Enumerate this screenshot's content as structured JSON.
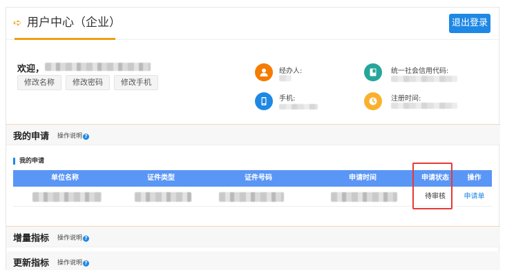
{
  "header": {
    "title": "用户中心（企业）",
    "logout_label": "退出登录",
    "accent_color": "#f39c12",
    "arrow_icon": "arrow-right-icon"
  },
  "profile": {
    "welcome_label": "欢迎，",
    "buttons": [
      "修改名称",
      "修改密码",
      "修改手机"
    ],
    "fields": [
      {
        "label": "经办人:",
        "icon": "person-icon",
        "color": "#f57c00"
      },
      {
        "label": "手机:",
        "icon": "phone-icon",
        "color": "#1e88e5"
      },
      {
        "label": "统一社会信用代码:",
        "icon": "book-icon",
        "color": "#26a69a"
      },
      {
        "label": "注册时间:",
        "icon": "clock-icon",
        "color": "#fbb02d"
      }
    ]
  },
  "sections": [
    {
      "title": "我的申请",
      "help": "操作说明"
    },
    {
      "title": "增量指标",
      "help": "操作说明"
    },
    {
      "title": "更新指标",
      "help": "操作说明"
    }
  ],
  "applications": {
    "sub_title": "我的申请",
    "columns": [
      "单位名称",
      "证件类型",
      "证件号码",
      "申请时间",
      "申请状态",
      "操作"
    ],
    "rows": [
      {
        "status": "待审核",
        "action": "申请单"
      }
    ]
  },
  "colors": {
    "primary": "#1e88e5",
    "table_header": "#5a96f5",
    "highlight_box": "#e53935"
  }
}
